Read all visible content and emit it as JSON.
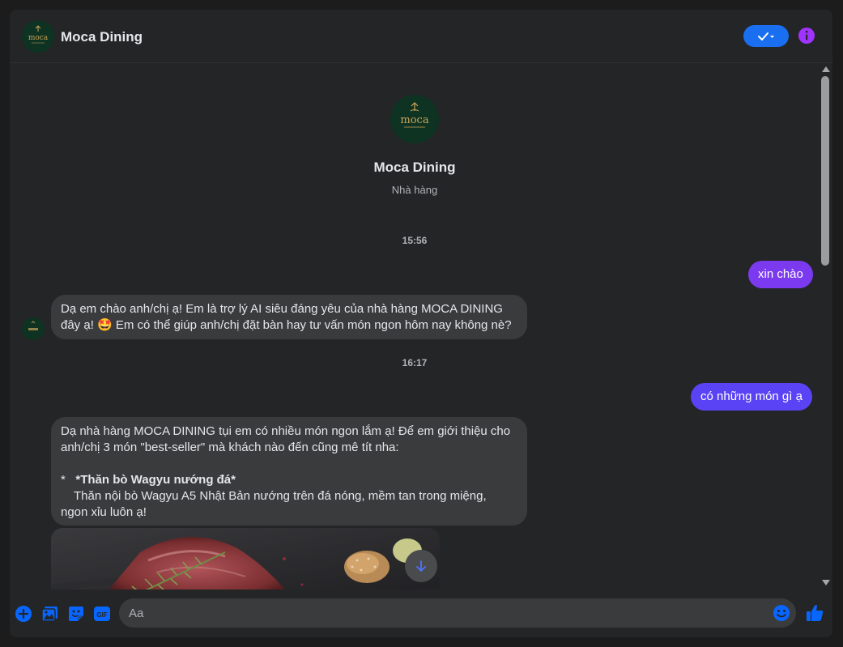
{
  "colors": {
    "accent": "#0866ff",
    "bubble_out_1": "#7b3af0",
    "bubble_out_2": "#5a43f5",
    "bubble_in": "#3a3b3c",
    "background": "#242526",
    "info": "#a033ff"
  },
  "header": {
    "title": "Moca Dining",
    "avatar_logo": "moca",
    "check_icon": "checkmark-icon",
    "check_chevron": "▾"
  },
  "profile": {
    "name": "Moca Dining",
    "category": "Nhà hàng",
    "logo": "moca"
  },
  "messages": [
    {
      "type": "timestamp",
      "text": "15:56"
    },
    {
      "type": "outgoing",
      "text": "xin chào"
    },
    {
      "type": "incoming",
      "line1": "Dạ em chào anh/chị ạ! Em là trợ lý AI siêu đáng yêu của nhà hàng MOCA DINING",
      "line2_pre": "đây ạ! ",
      "emoji": "🤩",
      "line2_post": " Em có thể giúp anh/chị đặt bàn hay tư vấn món ngon hôm nay không nè?"
    },
    {
      "type": "timestamp",
      "text": "16:17"
    },
    {
      "type": "outgoing",
      "text": "có những món gì ạ"
    },
    {
      "type": "incoming",
      "line1": "Dạ nhà hàng MOCA DINING tụi em có nhiều món ngon lắm ạ! Để em giới thiệu cho",
      "line2": "anh/chị 3 món \"best-seller\" mà khách nào đến cũng mê tít nha:",
      "bullet": "*",
      "dish_title": "*Thăn bò Wagyu nướng đá*",
      "dish_desc1": "Thăn nội bò Wagyu A5 Nhật Bản nướng trên đá nóng, mềm tan trong miệng,",
      "dish_desc2": "ngon xỉu luôn ạ!"
    }
  ],
  "composer": {
    "placeholder": "Aa",
    "icons": [
      "plus-circle-icon",
      "photo-icon",
      "sticker-icon",
      "gif-icon"
    ],
    "gif_label": "GIF",
    "emoji_icon": "smile-icon",
    "like_icon": "thumbs-up-icon"
  }
}
